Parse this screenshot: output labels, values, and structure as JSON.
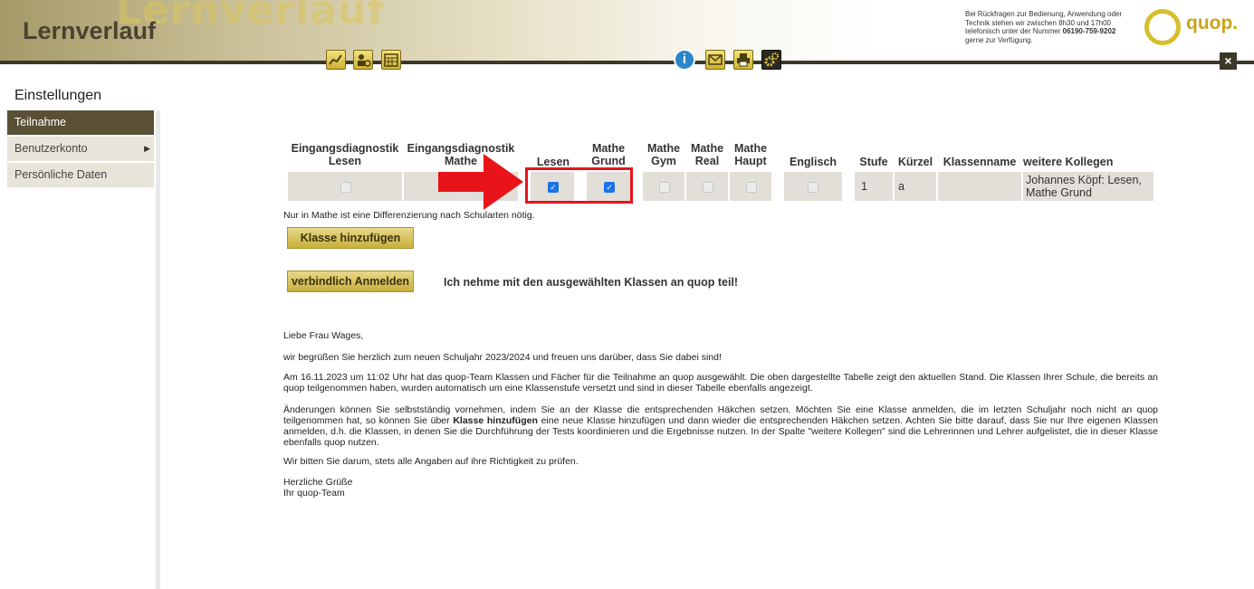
{
  "header": {
    "watermark": "Lernverlauf",
    "title": "Lernverlauf",
    "support_text": "Bei Rückfragen zur Bedienung, Anwendung oder Technik stehen wir zwischen 8h30 und 17h00 telefonisch unter der Nummer",
    "support_phone": "06190-759-9202",
    "support_suffix": "gerne zur Verfügung.",
    "logo_text": "quop.",
    "toolbar_left": [
      "chart-icon",
      "settings-person-icon",
      "calendar-icon"
    ],
    "toolbar_right": [
      "info-icon",
      "mail-icon",
      "print-icon",
      "gear-icon"
    ],
    "info_glyph": "i",
    "close_glyph": "×"
  },
  "sidebar": {
    "title": "Einstellungen",
    "items": [
      {
        "label": "Teilnahme",
        "active": true
      },
      {
        "label": "Benutzerkonto",
        "arrow": "▶"
      },
      {
        "label": "Persönliche Daten"
      }
    ]
  },
  "table": {
    "headers": [
      "Eingangsdiagnostik Lesen",
      "Eingangsdiagnostik Mathe",
      "Lesen",
      "Mathe Grund",
      "Mathe Gym",
      "Mathe Real",
      "Mathe Haupt",
      "Englisch",
      "Stufe",
      "Kürzel",
      "Klassenname",
      "weitere Kollegen"
    ],
    "row": {
      "eingang_lesen": false,
      "lesen": true,
      "mathe_grund": true,
      "mathe_gym": false,
      "mathe_real": false,
      "mathe_haupt": false,
      "englisch": false,
      "stufe": "1",
      "kuerzel": "a",
      "klassenname": "",
      "weitere_kollegen": "Johannes Köpf: Lesen, Mathe Grund"
    },
    "check_glyph": "✓"
  },
  "note": "Nur in Mathe ist eine Differenzierung nach Schularten nötig.",
  "buttons": {
    "add_class": "Klasse hinzufügen",
    "register": "verbindlich Anmelden"
  },
  "confirm_text": "Ich nehme mit den ausgewählten Klassen an quop teil!",
  "letter": {
    "greeting": "Liebe Frau Wages,",
    "p1": "wir begrüßen Sie herzlich zum neuen Schuljahr 2023/2024 und freuen uns darüber, dass Sie dabei sind!",
    "p2": "Am 16.11.2023 um 11:02 Uhr hat das quop-Team Klassen und Fächer für die Teilnahme an quop ausgewählt. Die oben dargestellte Tabelle zeigt den aktuellen Stand. Die Klassen Ihrer Schule, die bereits an quop teilgenommen haben, wurden automatisch um eine Klassenstufe versetzt und sind in dieser Tabelle ebenfalls angezeigt.",
    "p3_a": "Änderungen können Sie selbstständig vornehmen, indem Sie an der Klasse die entsprechenden Häkchen setzen. Möchten Sie eine Klasse anmelden, die im letzten Schuljahr noch nicht an quop teilgenommen hat, so können Sie über",
    "p3_bold": "Klasse hinzufügen",
    "p3_b": "eine neue Klasse hinzufügen und dann wieder die entsprechenden Häkchen setzen. Achten Sie bitte darauf, dass Sie nur Ihre eigenen Klassen anmelden, d.h. die Klassen, in denen Sie die Durchführung der Tests koordinieren und die Ergebnisse nutzen. In der Spalte \"weitere Kollegen\" sind die Lehrerinnen und Lehrer aufgelistet, die in dieser Klasse ebenfalls quop nutzen.",
    "p4": "Wir bitten Sie darum, stets alle Angaben auf ihre Richtigkeit zu prüfen.",
    "closing1": "Herzliche Grüße",
    "closing2": "Ihr quop-Team"
  },
  "colors": {
    "sidebar_active": "#5a5036",
    "highlight": "#e8141a",
    "button_gold": "#d6c25a",
    "checkbox_checked": "#1a73e8"
  }
}
